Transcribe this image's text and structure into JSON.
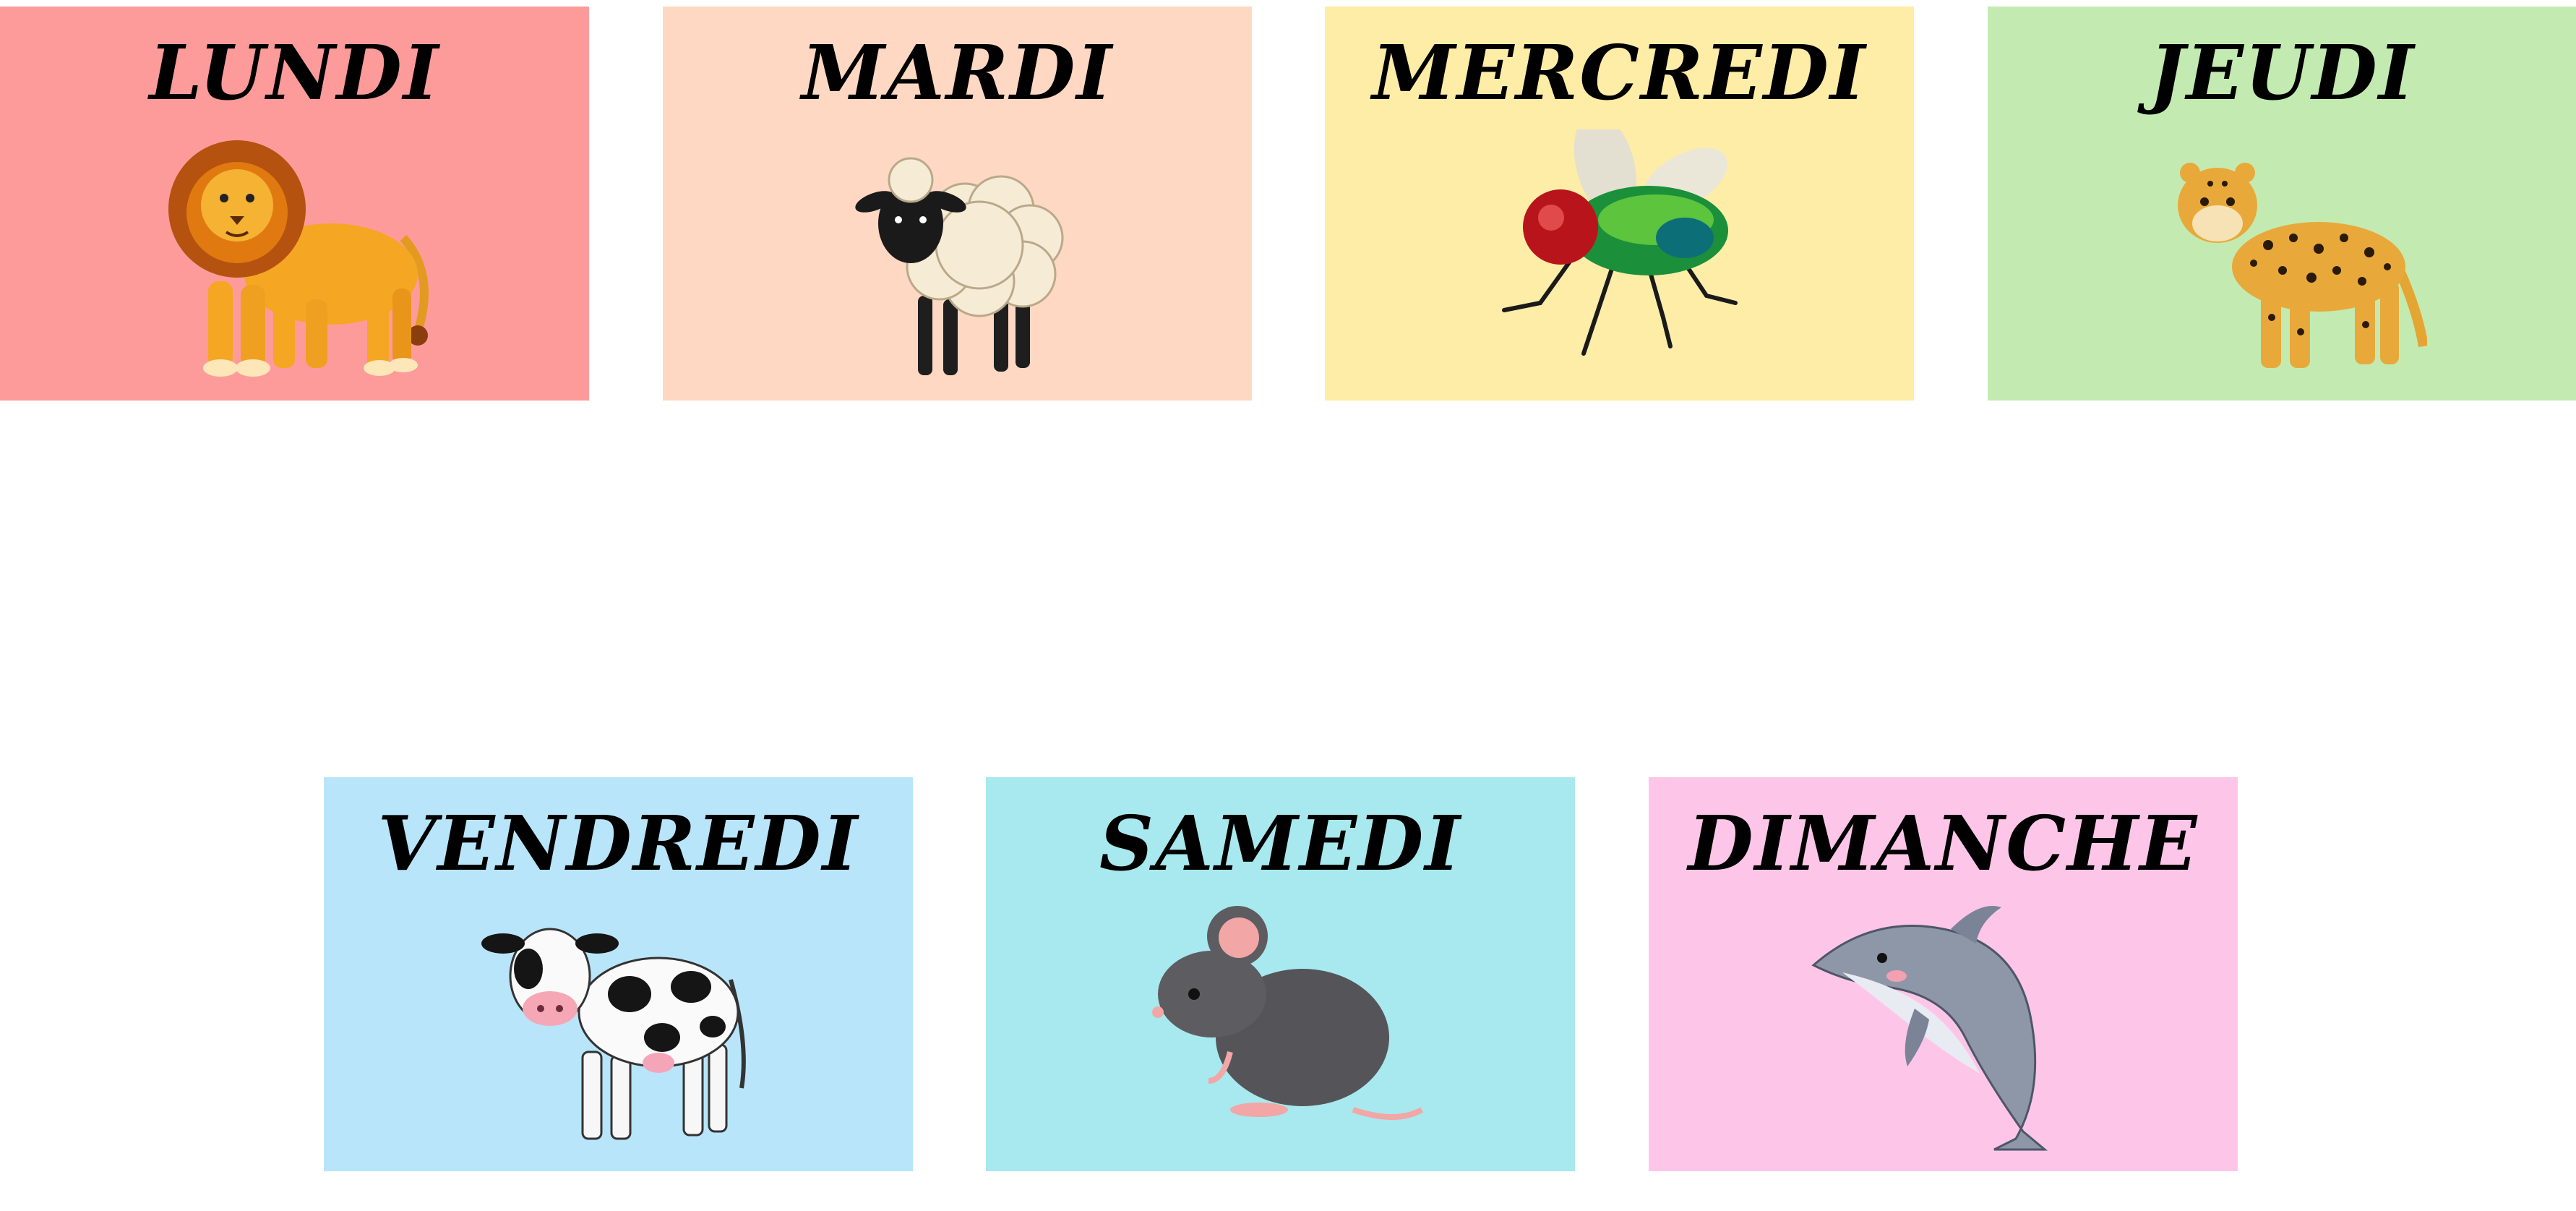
{
  "cards": [
    {
      "title": "LUNDI",
      "animal_icon": "lion-icon",
      "background": "#fd9b9b"
    },
    {
      "title": "MARDI",
      "animal_icon": "sheep-icon",
      "background": "#fed8c3"
    },
    {
      "title": "MERCREDI",
      "animal_icon": "fly-icon",
      "background": "#feeda7"
    },
    {
      "title": "JEUDI",
      "animal_icon": "leopard-icon",
      "background": "#c3ebb1"
    },
    {
      "title": "VENDREDI",
      "animal_icon": "cow-icon",
      "background": "#b8e5fa"
    },
    {
      "title": "SAMEDI",
      "animal_icon": "mouse-icon",
      "background": "#a7e9ee"
    },
    {
      "title": "DIMANCHE",
      "animal_icon": "dolphin-icon",
      "background": "#fdc6e9"
    }
  ]
}
